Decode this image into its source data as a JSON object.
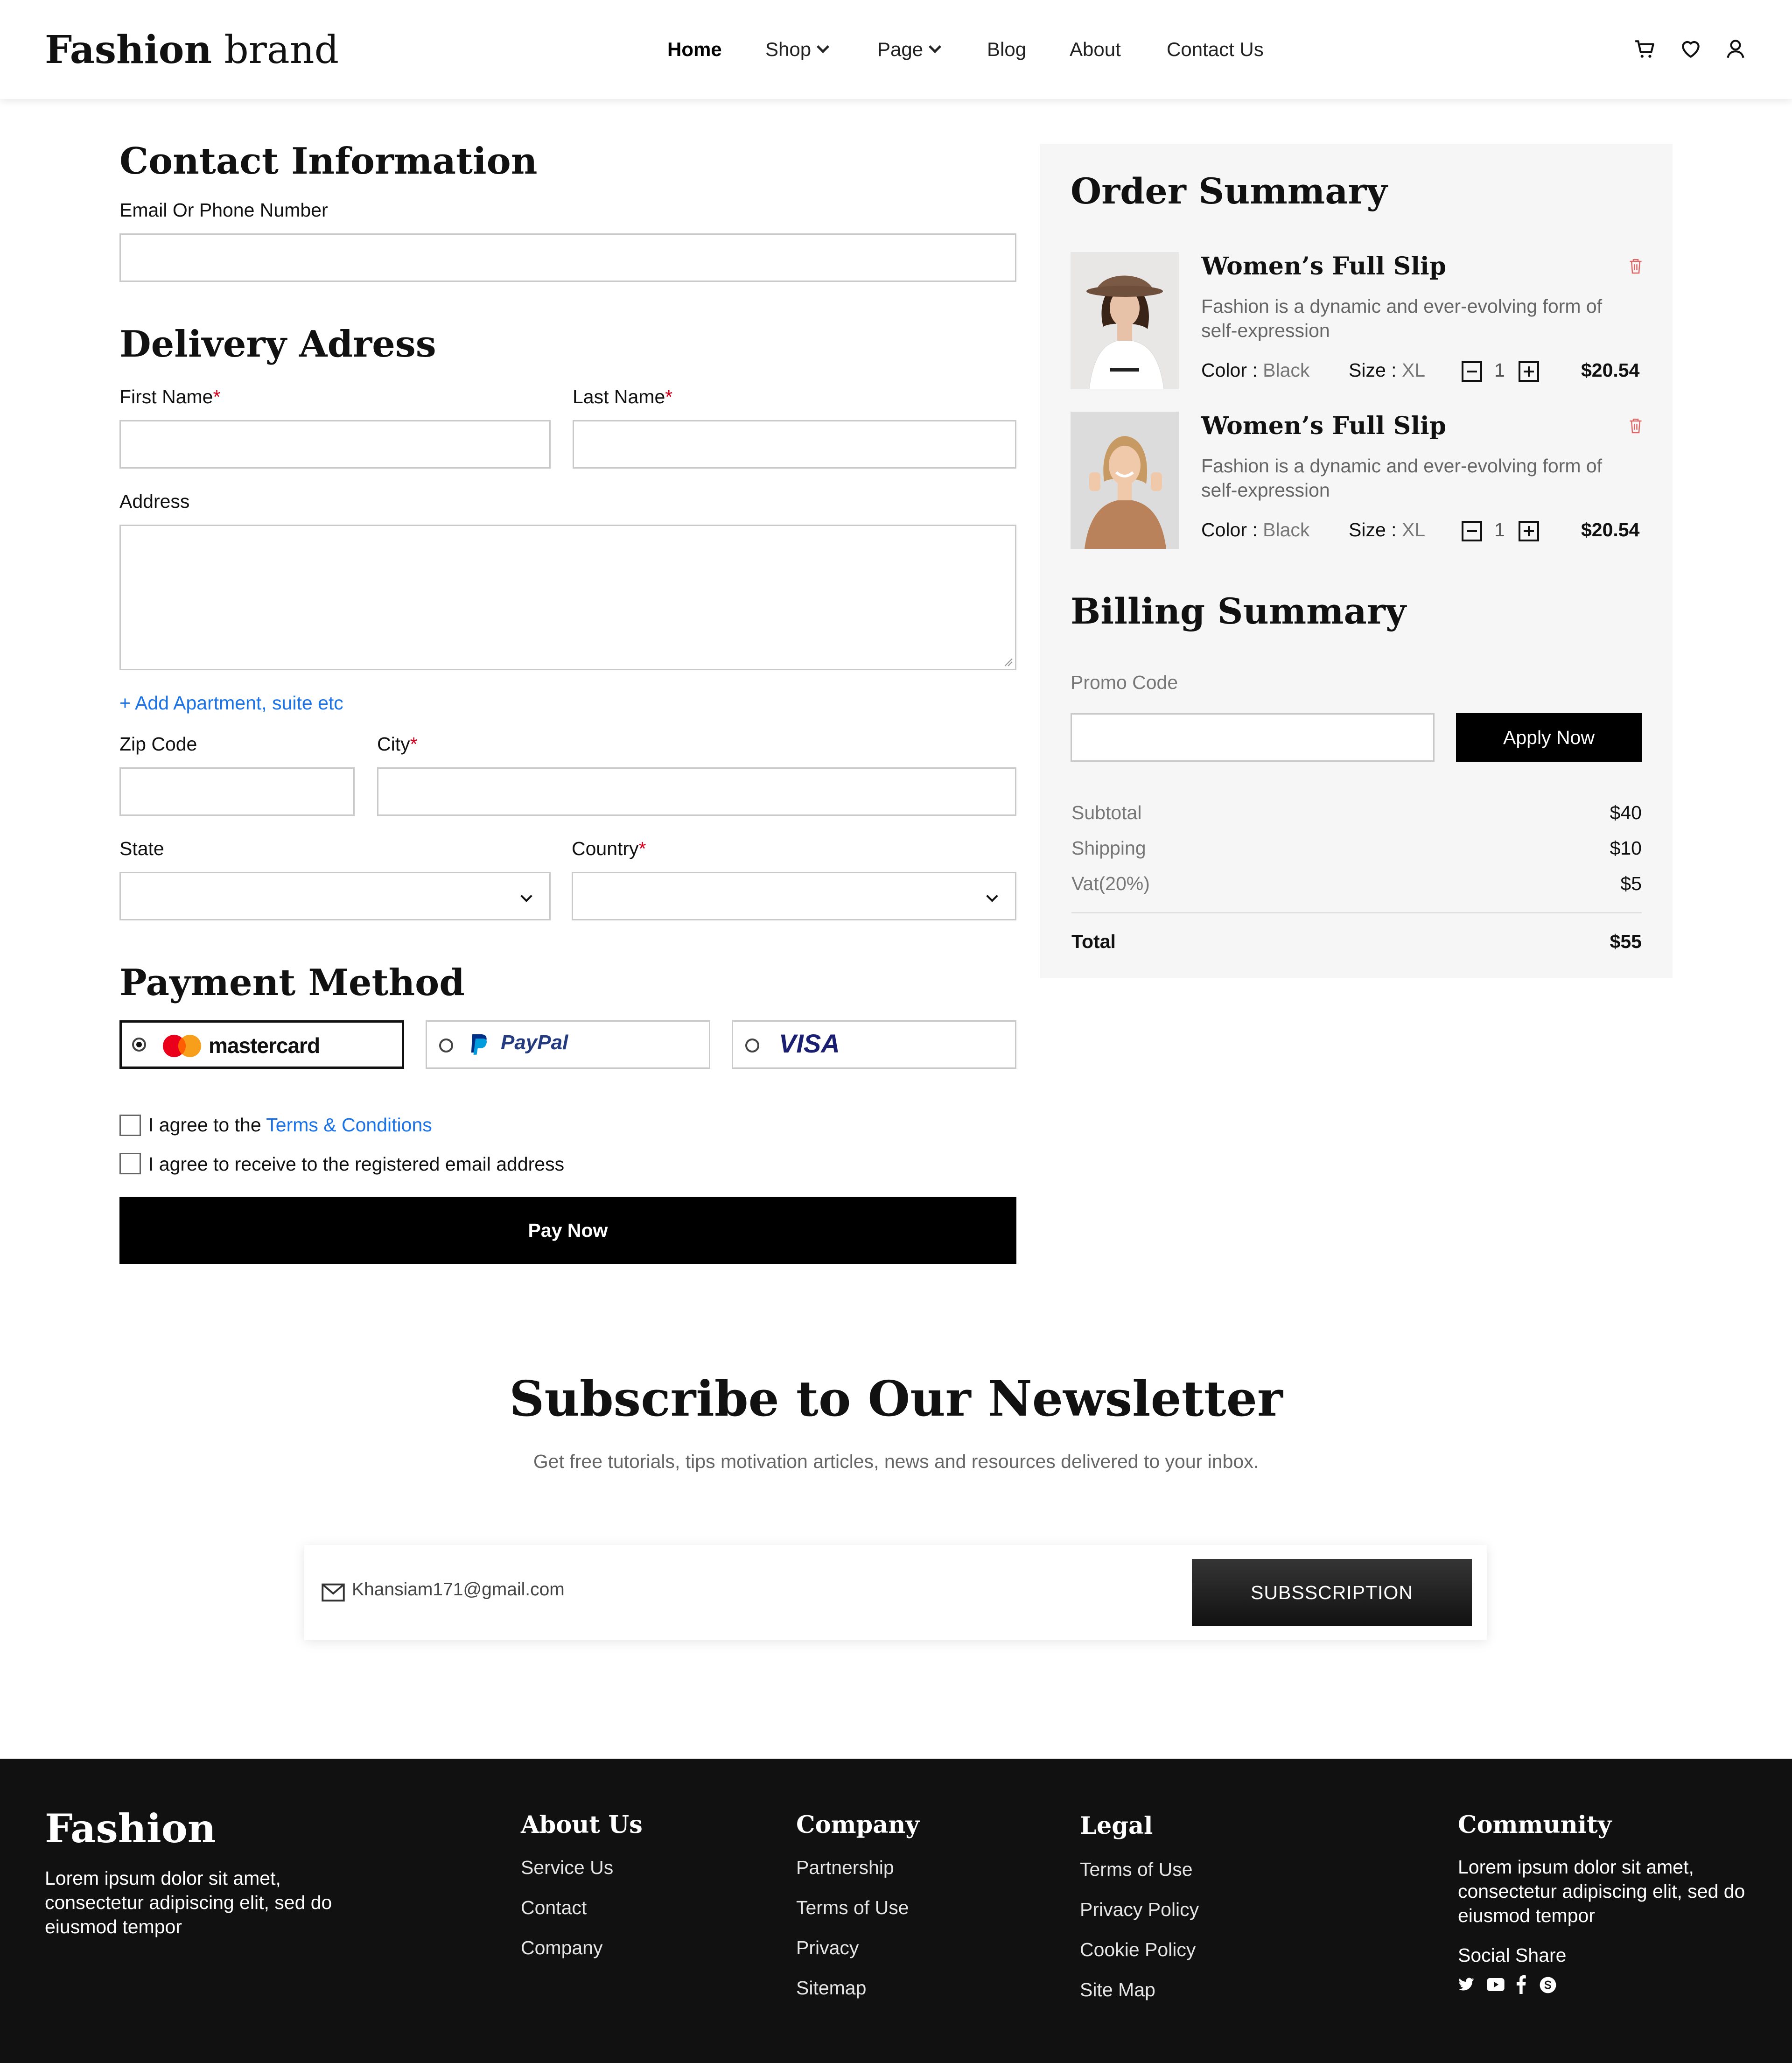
{
  "header": {
    "logo_bold": "Fashion",
    "logo_light": "brand",
    "nav": [
      "Home",
      "Shop",
      "Page",
      "Blog",
      "About",
      "Contact Us"
    ]
  },
  "contact": {
    "title": "Contact Information",
    "email_label": "Email Or Phone Number"
  },
  "delivery": {
    "title": "Delivery Adress",
    "first_name": "First Name",
    "last_name": "Last Name",
    "address": "Address",
    "add_apartment": "+ Add Apartment, suite etc",
    "zip": "Zip Code",
    "city": "City",
    "state": "State",
    "country": "Country",
    "required_mark": "*"
  },
  "payment": {
    "title": "Payment Method",
    "options": [
      "mastercard",
      "PayPal",
      "VISA"
    ],
    "selected": "mastercard",
    "agree_prefix": "I agree to the ",
    "agree_link": "Terms & Conditions",
    "agree_email": "I agree to receive to the registered email address",
    "pay_button": "Pay Now"
  },
  "order": {
    "title": "Order Summary",
    "items": [
      {
        "name": "Women’s Full Slip",
        "desc": "Fashion is a dynamic and ever-evolving form of self-expression",
        "color_label": "Color :",
        "color": "Black",
        "size_label": "Size :",
        "size": "XL",
        "qty": "1",
        "price": "$20.54"
      },
      {
        "name": "Women’s Full Slip",
        "desc": "Fashion is a dynamic and ever-evolving form of self-expression",
        "color_label": "Color :",
        "color": "Black",
        "size_label": "Size :",
        "size": "XL",
        "qty": "1",
        "price": "$20.54"
      }
    ]
  },
  "billing": {
    "title": "Billing Summary",
    "promo_label": "Promo Code",
    "apply": "Apply Now",
    "rows": [
      {
        "label": "Subtotal",
        "value": "$40"
      },
      {
        "label": "Shipping",
        "value": "$10"
      },
      {
        "label": "Vat(20%)",
        "value": "$5"
      }
    ],
    "total_label": "Total",
    "total_value": "$55"
  },
  "newsletter": {
    "title": "Subscribe to Our Newsletter",
    "subtitle": "Get free tutorials, tips motivation articles, news and resources delivered to your inbox.",
    "email_value": "Khansiam171@gmail.com",
    "button": "SUBSSCRIPTION"
  },
  "footer": {
    "brand": "Fashion",
    "brand_text": "Lorem ipsum dolor sit amet, consectetur adipiscing elit, sed do eiusmod tempor",
    "about": {
      "title": "About Us",
      "links": [
        "Service Us",
        "Contact",
        "Company"
      ]
    },
    "company": {
      "title": "Company",
      "links": [
        "Partnership",
        "Terms of Use",
        "Privacy",
        "Sitemap"
      ]
    },
    "legal": {
      "title": "Legal",
      "links": [
        "Terms of Use",
        "Privacy Policy",
        "Cookie Policy",
        "Site Map"
      ]
    },
    "community": {
      "title": "Community",
      "text": "Lorem ipsum dolor sit amet, consectetur adipiscing elit, sed do eiusmod tempor",
      "social_label": "Social Share"
    }
  },
  "colors": {
    "accent_blue": "#1a73e8",
    "required_red": "#d6001c",
    "footer_bg": "#111111"
  }
}
